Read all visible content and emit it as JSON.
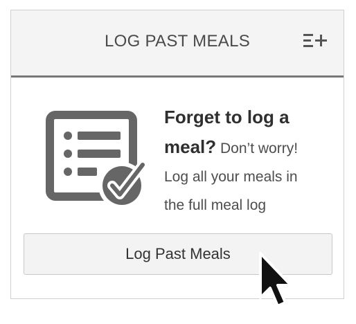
{
  "header": {
    "title": "LOG PAST MEALS",
    "action_icon": "list-add-icon"
  },
  "promo": {
    "icon": "checklist-check-icon",
    "lead_line1": "Forget to log a",
    "lead_line2": "meal?",
    "body_line1": "Don’t worry!",
    "body_line2": "Log all your meals in",
    "body_line3": "the full meal log"
  },
  "button": {
    "label": "Log Past Meals"
  },
  "cursor": {
    "icon": "mouse-pointer-icon"
  },
  "colors": {
    "header_bg": "#f4f4f4",
    "header_rule": "#777777",
    "icon_gray": "#666666",
    "button_bg": "#f3f3f3"
  }
}
